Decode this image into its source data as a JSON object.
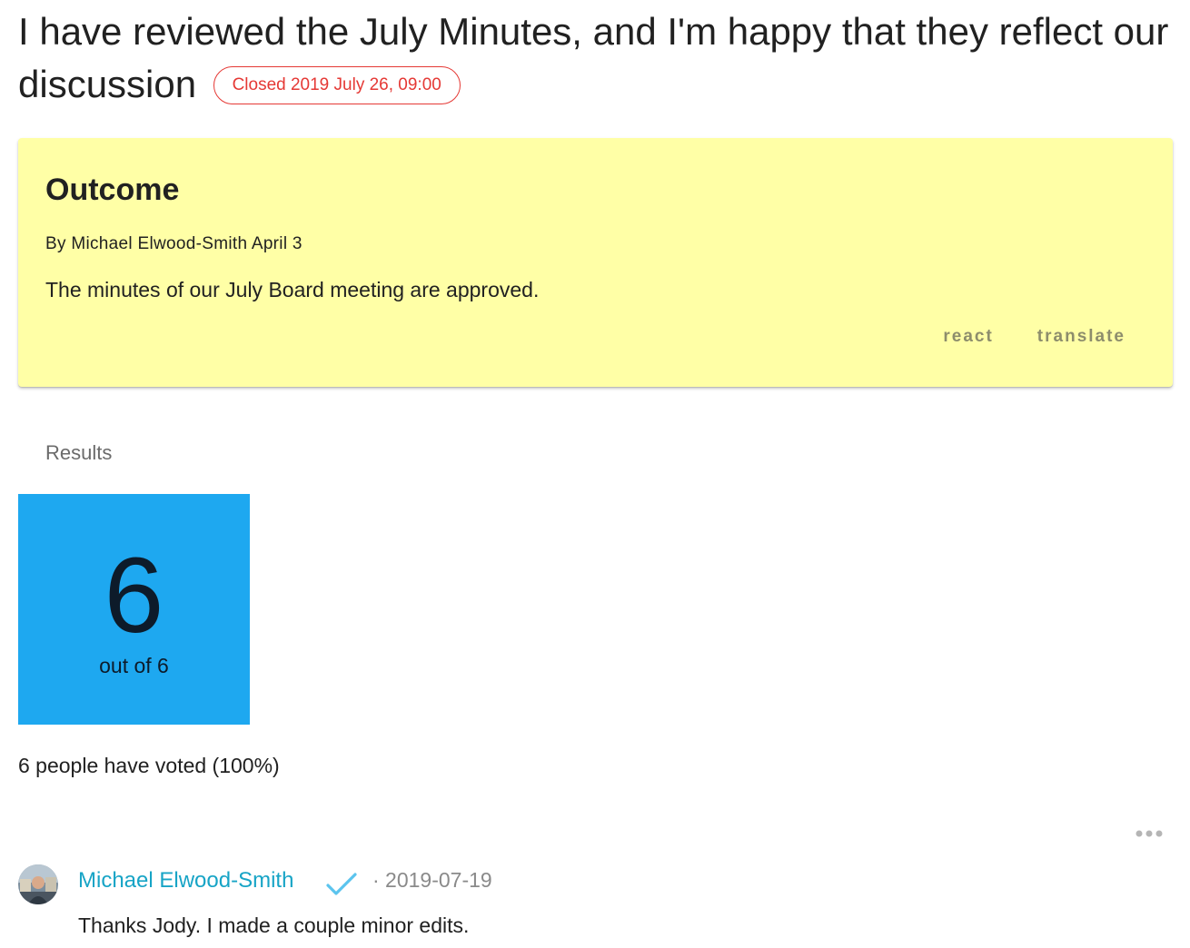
{
  "poll": {
    "title": "I have reviewed the July Minutes, and I'm happy that they reflect our discussion",
    "closed_badge": "Closed 2019 July 26, 09:00"
  },
  "outcome": {
    "heading": "Outcome",
    "byline": "By Michael Elwood-Smith April 3",
    "statement": "The minutes of our July Board meeting are approved.",
    "actions": {
      "react": "react",
      "translate": "translate"
    },
    "background_color": "#ffffa6"
  },
  "results": {
    "heading": "Results",
    "count": "6",
    "out_of": "out of 6",
    "tile_color": "#1ea8f0",
    "summary": "6 people have voted (100%)"
  },
  "comment": {
    "author": "Michael Elwood-Smith",
    "separator_date": "· 2019-07-19",
    "body": "Thanks Jody. I made a couple minor edits.",
    "author_color": "#17a4c6",
    "verified_icon": "check-icon",
    "menu_icon": "more-horiz-icon"
  },
  "colors": {
    "closed": "#e53935",
    "text": "#212121",
    "muted": "#8a8a8a"
  }
}
